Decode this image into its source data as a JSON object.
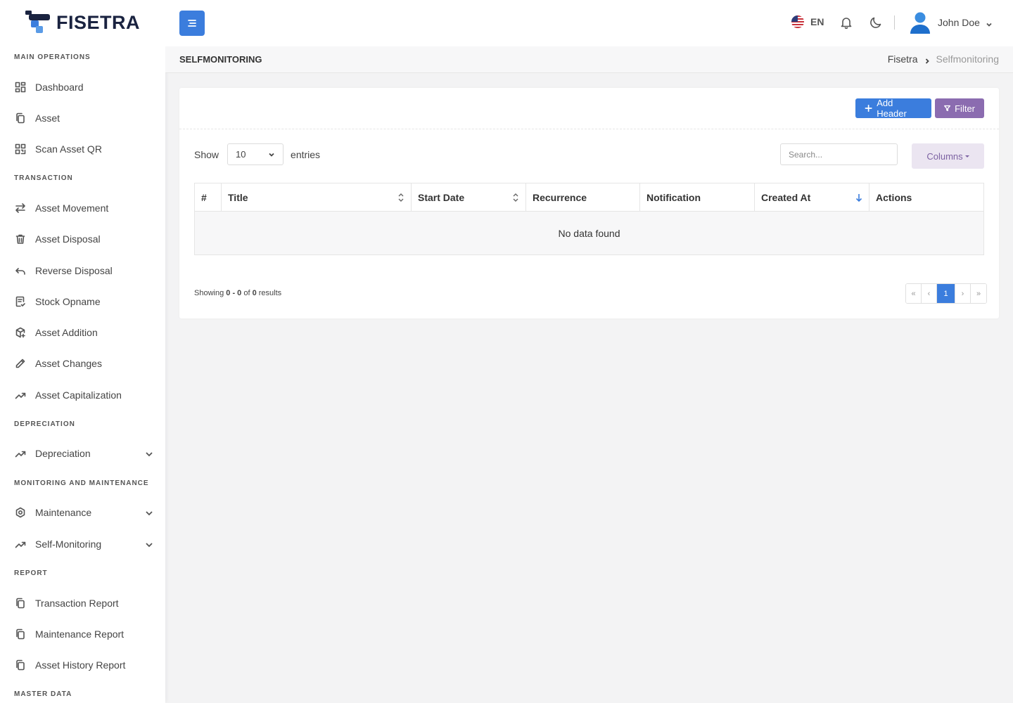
{
  "brand": {
    "name": "FISETRA"
  },
  "sidebar": {
    "sections": [
      {
        "title": "MAIN OPERATIONS"
      },
      {
        "title": "TRANSACTION"
      },
      {
        "title": "DEPRECIATION"
      },
      {
        "title": "MONITORING AND MAINTENANCE"
      },
      {
        "title": "REPORT"
      },
      {
        "title": "MASTER DATA"
      }
    ],
    "items": [
      {
        "label": "Dashboard",
        "icon": "dashboard-icon"
      },
      {
        "label": "Asset",
        "icon": "copy-icon"
      },
      {
        "label": "Scan Asset QR",
        "icon": "qr-icon"
      },
      {
        "label": "Asset Movement",
        "icon": "arrows-swap-icon"
      },
      {
        "label": "Asset Disposal",
        "icon": "trash-icon"
      },
      {
        "label": "Reverse Disposal",
        "icon": "undo-icon"
      },
      {
        "label": "Stock Opname",
        "icon": "clipboard-check-icon"
      },
      {
        "label": "Asset Addition",
        "icon": "box-plus-icon"
      },
      {
        "label": "Asset Changes",
        "icon": "pencil-icon"
      },
      {
        "label": "Asset Capitalization",
        "icon": "trending-up-icon"
      },
      {
        "label": "Depreciation",
        "icon": "trending-up-icon",
        "expandable": true
      },
      {
        "label": "Maintenance",
        "icon": "hexagon-gear-icon",
        "expandable": true
      },
      {
        "label": "Self-Monitoring",
        "icon": "trending-up-icon",
        "expandable": true
      },
      {
        "label": "Transaction Report",
        "icon": "copy-icon"
      },
      {
        "label": "Maintenance Report",
        "icon": "copy-icon"
      },
      {
        "label": "Asset History Report",
        "icon": "copy-icon"
      }
    ]
  },
  "header": {
    "language": "EN",
    "user_name": "John Doe"
  },
  "page": {
    "title": "SELFMONITORING",
    "breadcrumb": {
      "home": "Fisetra",
      "current": "Selfmonitoring"
    }
  },
  "toolbar": {
    "add_label": "Add Header",
    "filter_label": "Filter"
  },
  "table_controls": {
    "show_label": "Show",
    "page_size": "10",
    "entries_label": "entries",
    "search_placeholder": "Search...",
    "columns_label": "Columns"
  },
  "table": {
    "columns": [
      "#",
      "Title",
      "Start Date",
      "Recurrence",
      "Notification",
      "Created At",
      "Actions"
    ],
    "empty_text": "No data found"
  },
  "footer": {
    "showing_prefix": "Showing ",
    "range": "0 - 0",
    "of": " of ",
    "total": "0",
    "suffix": " results"
  },
  "pagination": {
    "first": "«",
    "prev": "‹",
    "current": "1",
    "next": "›",
    "last": "»"
  },
  "colors": {
    "primary": "#3b7ddd",
    "filter": "#8b6cb0",
    "columns_bg": "#ebe5f1",
    "brand_dark": "#1a2340"
  }
}
